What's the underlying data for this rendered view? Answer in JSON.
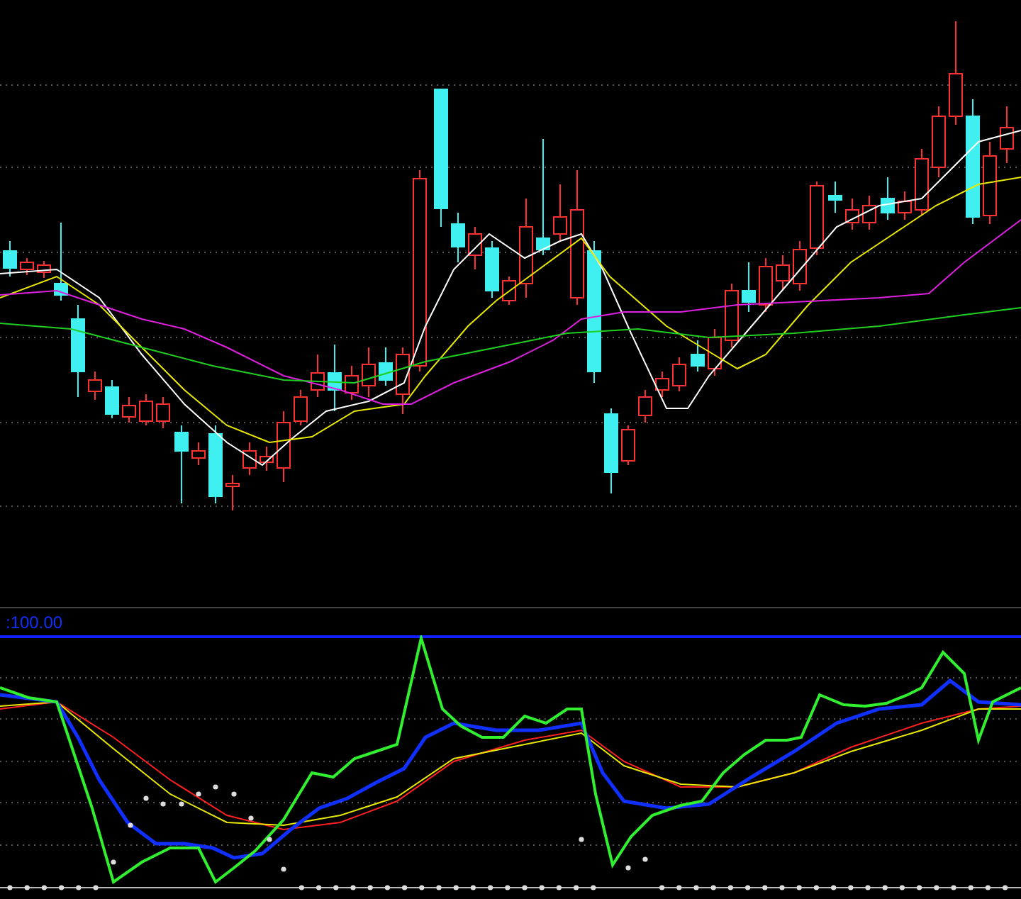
{
  "indicator_panel": {
    "level_label": ":100.00"
  }
}
